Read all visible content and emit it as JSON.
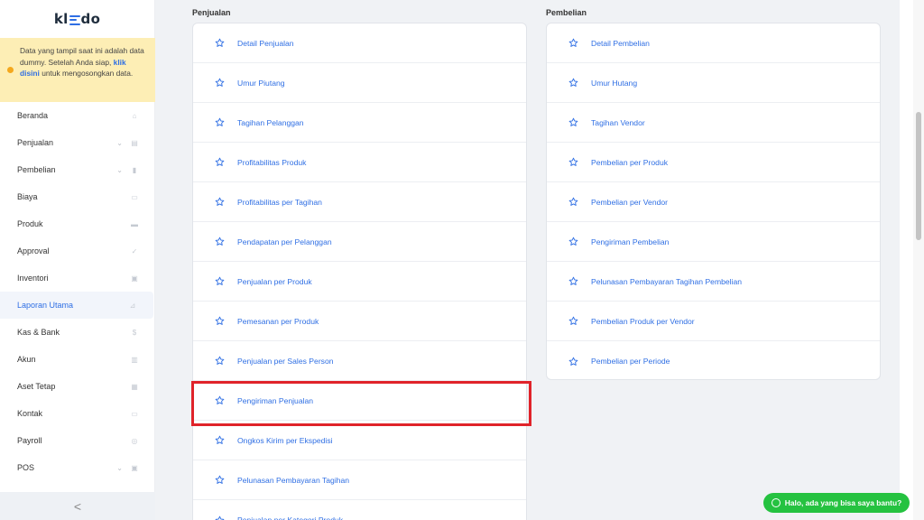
{
  "sidebar": {
    "logo_left": "kl",
    "logo_right": "do",
    "notice": {
      "text_before": "Data yang tampil saat ini adalah data dummy. Setelah Anda siap,",
      "link": "klik disini",
      "text_after": " untuk mengosongkan data."
    },
    "items": [
      {
        "label": "Beranda",
        "icon": "home-icon",
        "chevron": false
      },
      {
        "label": "Penjualan",
        "icon": "basket-icon",
        "chevron": true
      },
      {
        "label": "Pembelian",
        "icon": "bag-icon",
        "chevron": true
      },
      {
        "label": "Biaya",
        "icon": "card-icon",
        "chevron": false
      },
      {
        "label": "Produk",
        "icon": "box-icon",
        "chevron": false
      },
      {
        "label": "Approval",
        "icon": "check-icon",
        "chevron": false
      },
      {
        "label": "Inventori",
        "icon": "briefcase-icon",
        "chevron": false
      },
      {
        "label": "Laporan Utama",
        "icon": "chart-icon",
        "chevron": false,
        "active": true
      },
      {
        "label": "Kas & Bank",
        "icon": "dollar-icon",
        "chevron": false
      },
      {
        "label": "Akun",
        "icon": "book-icon",
        "chevron": false
      },
      {
        "label": "Aset Tetap",
        "icon": "building-icon",
        "chevron": false
      },
      {
        "label": "Kontak",
        "icon": "contact-icon",
        "chevron": false
      },
      {
        "label": "Payroll",
        "icon": "payroll-icon",
        "chevron": false
      },
      {
        "label": "POS",
        "icon": "pos-icon",
        "chevron": true
      }
    ],
    "collapse_label": "<"
  },
  "penjualan": {
    "title": "Penjualan",
    "items": [
      "Detail Penjualan",
      "Umur Piutang",
      "Tagihan Pelanggan",
      "Profitabilitas Produk",
      "Profitabilitas per Tagihan",
      "Pendapatan per Pelanggan",
      "Penjualan per Produk",
      "Pemesanan per Produk",
      "Penjualan per Sales Person",
      "Pengiriman Penjualan",
      "Ongkos Kirim per Ekspedisi",
      "Pelunasan Pembayaran Tagihan",
      "Penjualan per Kategori Produk"
    ]
  },
  "pembelian": {
    "title": "Pembelian",
    "items": [
      "Detail Pembelian",
      "Umur Hutang",
      "Tagihan Vendor",
      "Pembelian per Produk",
      "Pembelian per Vendor",
      "Pengiriman Pembelian",
      "Pelunasan Pembayaran Tagihan Pembelian",
      "Pembelian Produk per Vendor",
      "Pembelian per Periode"
    ]
  },
  "chat": {
    "label": "Halo, ada yang bisa saya bantu?"
  },
  "colors": {
    "accent": "#2f6fe4",
    "highlight": "#e0232a",
    "chat": "#25c240",
    "notice_bg": "#fdeeb5"
  }
}
